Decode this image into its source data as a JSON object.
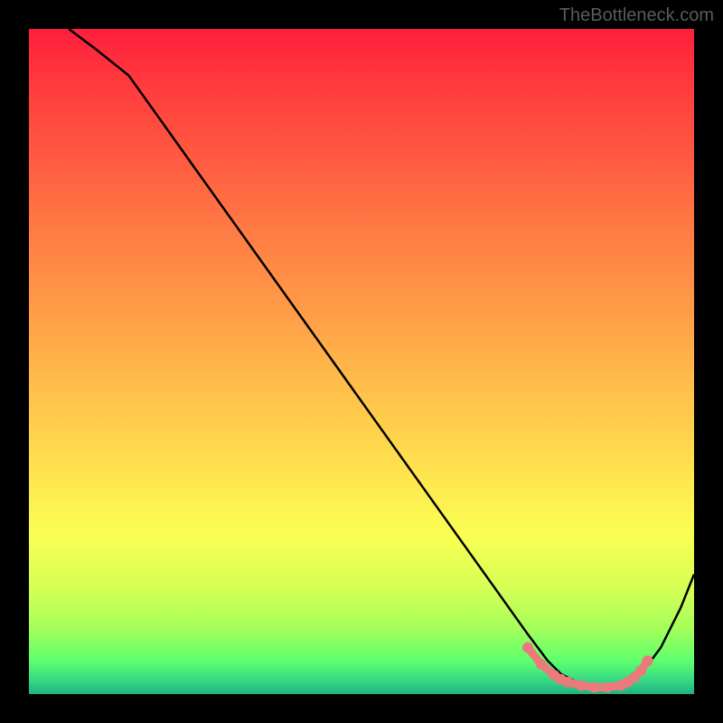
{
  "watermark": "TheBottleneck.com",
  "chart_data": {
    "type": "line",
    "title": "",
    "xlabel": "",
    "ylabel": "",
    "xlim": [
      0,
      100
    ],
    "ylim": [
      0,
      100
    ],
    "series": [
      {
        "name": "curve",
        "x": [
          6,
          10,
          15,
          20,
          25,
          30,
          35,
          40,
          45,
          50,
          55,
          60,
          65,
          70,
          75,
          78,
          80,
          82,
          84,
          86,
          88,
          90,
          92,
          95,
          98,
          100
        ],
        "y": [
          100,
          97,
          93,
          86,
          79,
          72,
          65,
          58,
          51,
          44,
          37,
          30,
          23,
          16,
          9,
          5,
          3,
          2,
          1.3,
          1,
          1,
          1.3,
          3,
          7,
          13,
          18
        ]
      }
    ],
    "highlight_points": {
      "x": [
        75,
        77,
        79,
        80,
        81,
        83,
        85,
        87,
        89,
        90,
        91,
        92,
        93
      ],
      "y": [
        7,
        4.5,
        2.8,
        2.2,
        1.8,
        1.3,
        1,
        1,
        1.3,
        1.8,
        2.5,
        3.5,
        5
      ]
    }
  },
  "colors": {
    "curve": "#000000",
    "highlight": "#eb7a7d",
    "background_border": "#000000"
  }
}
